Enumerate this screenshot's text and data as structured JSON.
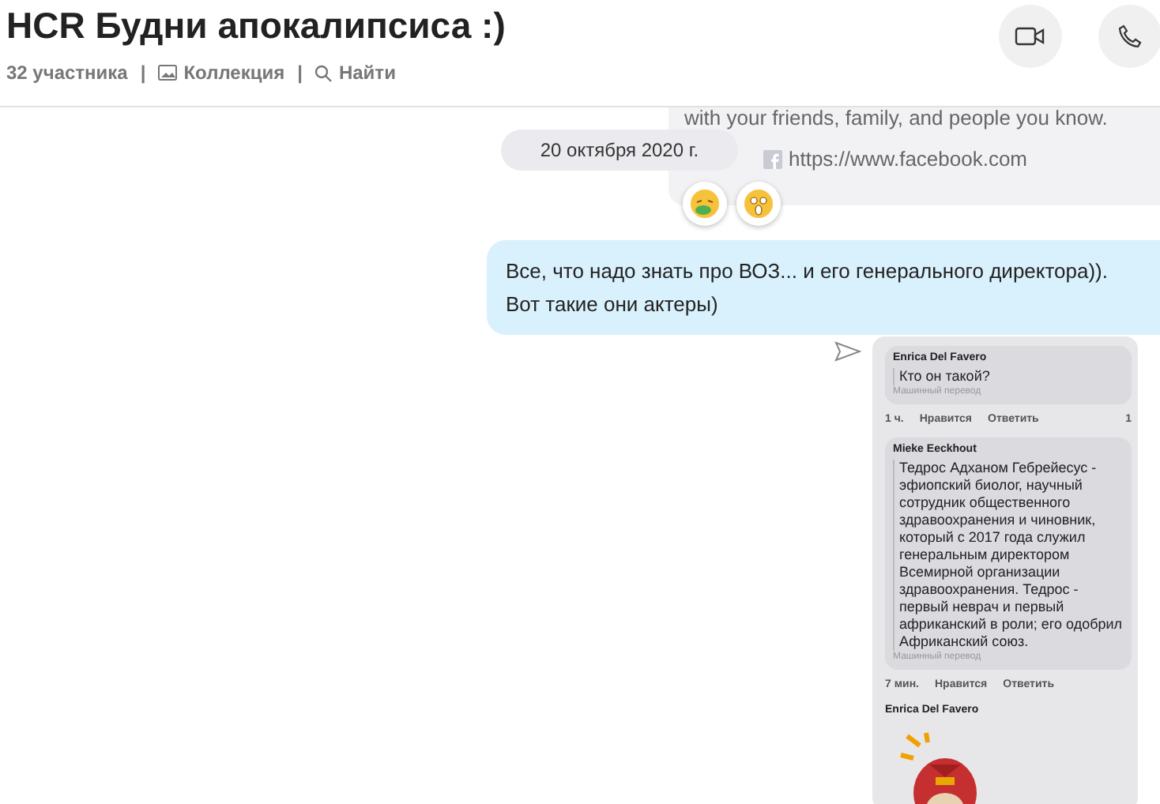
{
  "header": {
    "title": "HCR Будни апокалипсиса :)",
    "participants": "32 участника",
    "separator": "|",
    "collection": "Коллекция",
    "search": "Найти"
  },
  "call_buttons": [
    {
      "kind": "video"
    },
    {
      "kind": "audio"
    }
  ],
  "link_preview": {
    "description": "with your friends, family, and people you know.",
    "url": "https://www.facebook.com"
  },
  "date_separator": "20 октября 2020 г.",
  "reactions": [
    {
      "kind": "sick"
    },
    {
      "kind": "shocked"
    }
  ],
  "message": {
    "text": "Все, что надо знать про ВОЗ... и его генерального директора)). Вот такие они актеры)"
  },
  "shared_screenshot": {
    "comments": [
      {
        "kind": "text",
        "author": "Enrica Del Favero",
        "text": "Кто он такой?",
        "note": "Машинный перевод",
        "time": "1 ч.",
        "like": "Нравится",
        "reply": "Ответить",
        "reaction_count": "1"
      },
      {
        "kind": "text",
        "author": "Mieke Eeckhout",
        "text": "Тедрос Адханом Гебрейесус - эфиопский биолог, научный сотрудник общественного здравоохранения и чиновник, который с 2017 года служил генеральным директором Всемирной организации здравоохранения. Тедрос - первый неврач и первый африканский в роли; его одобрил Африканский союз.",
        "note": "Машинный перевод",
        "time": "7 мин.",
        "like": "Нравится",
        "reply": "Ответить"
      },
      {
        "kind": "sticker",
        "author": "Enrica Del Favero"
      }
    ]
  }
}
